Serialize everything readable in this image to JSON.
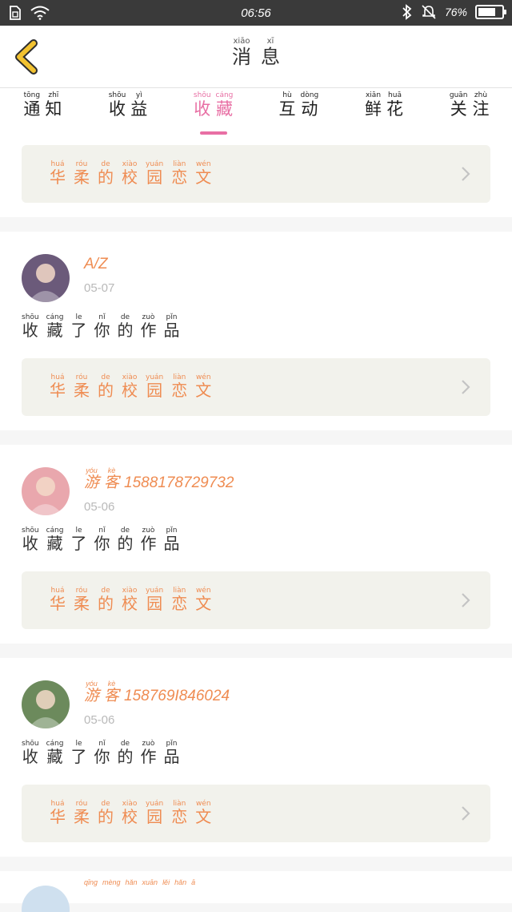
{
  "status_bar": {
    "time": "06:56",
    "battery": "76%",
    "battery_level": 0.76
  },
  "header": {
    "title": [
      {
        "char": "消",
        "pinyin": "xiāo"
      },
      {
        "char": "息",
        "pinyin": "xī"
      }
    ]
  },
  "tabs": [
    {
      "label": [
        {
          "char": "通",
          "pinyin": "tōng"
        },
        {
          "char": "知",
          "pinyin": "zhī"
        }
      ]
    },
    {
      "label": [
        {
          "char": "收",
          "pinyin": "shōu"
        },
        {
          "char": "益",
          "pinyin": "yì"
        }
      ]
    },
    {
      "label": [
        {
          "char": "收",
          "pinyin": "shōu"
        },
        {
          "char": "藏",
          "pinyin": "cáng"
        }
      ],
      "active": true
    },
    {
      "label": [
        {
          "char": "互",
          "pinyin": "hù"
        },
        {
          "char": "动",
          "pinyin": "dòng"
        }
      ]
    },
    {
      "label": [
        {
          "char": "鲜",
          "pinyin": "xiān"
        },
        {
          "char": "花",
          "pinyin": "huā"
        }
      ]
    },
    {
      "label": [
        {
          "char": "关",
          "pinyin": "guān"
        },
        {
          "char": "注",
          "pinyin": "zhù"
        }
      ]
    }
  ],
  "work_title": [
    {
      "char": "华",
      "pinyin": "huá"
    },
    {
      "char": "柔",
      "pinyin": "róu"
    },
    {
      "char": "的",
      "pinyin": "de"
    },
    {
      "char": "校",
      "pinyin": "xiào"
    },
    {
      "char": "园",
      "pinyin": "yuán"
    },
    {
      "char": "恋",
      "pinyin": "liàn"
    },
    {
      "char": "文",
      "pinyin": "wén"
    }
  ],
  "action_text": [
    {
      "char": "收",
      "pinyin": "shōu"
    },
    {
      "char": "藏",
      "pinyin": "cáng"
    },
    {
      "char": "了",
      "pinyin": "le"
    },
    {
      "char": "你",
      "pinyin": "nǐ"
    },
    {
      "char": "的",
      "pinyin": "de"
    },
    {
      "char": "作",
      "pinyin": "zuò"
    },
    {
      "char": "品",
      "pinyin": "pǐn"
    }
  ],
  "items": [
    {
      "user": "A/Z",
      "user_prefix": [],
      "date": "05-07",
      "avatar_color": "#6b5a7a"
    },
    {
      "user": "1588178729732",
      "user_prefix": [
        {
          "char": "游",
          "pinyin": "yóu"
        },
        {
          "char": "客",
          "pinyin": "kè"
        }
      ],
      "date": "05-06",
      "avatar_color": "#e9a7ad"
    },
    {
      "user": "158769I846024",
      "user_prefix": [
        {
          "char": "游",
          "pinyin": "yóu"
        },
        {
          "char": "客",
          "pinyin": "kè"
        }
      ],
      "date": "05-06",
      "avatar_color": "#6c8a5c"
    }
  ],
  "partial_item_user": [
    {
      "char": "",
      "pinyin": "qīng"
    },
    {
      "char": "",
      "pinyin": "mèng"
    },
    {
      "char": "",
      "pinyin": "hǎn"
    },
    {
      "char": "",
      "pinyin": "xuān"
    },
    {
      "char": "",
      "pinyin": "lěi"
    },
    {
      "char": "",
      "pinyin": "hǎn"
    },
    {
      "char": "",
      "pinyin": "ā"
    }
  ],
  "colors": {
    "accent_pink": "#e86fa4",
    "accent_orange": "#ef8c52",
    "back_arrow": "#f2c230"
  },
  "icons": {
    "back": "chevron-left-icon",
    "row_arrow": "chevron-right-icon"
  }
}
